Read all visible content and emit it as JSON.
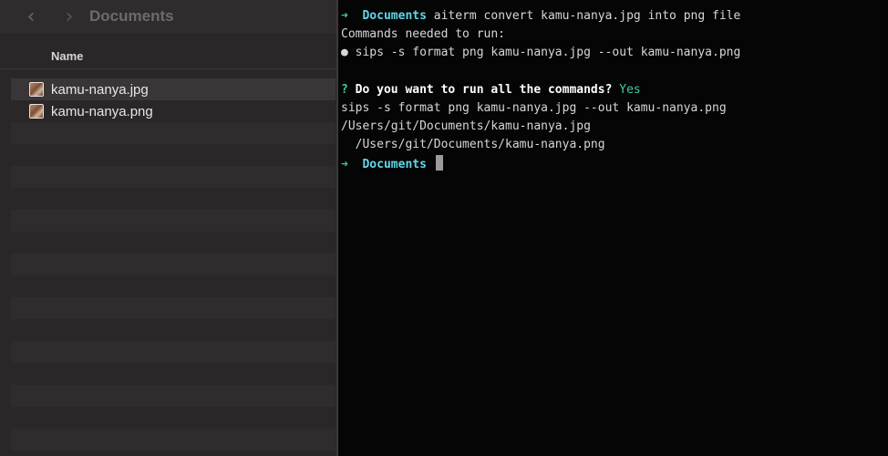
{
  "finder": {
    "title": "Documents",
    "back_icon": "chevron-left-icon",
    "forward_icon": "chevron-right-icon",
    "column_name": "Name",
    "files": [
      {
        "name": "kamu-nanya.jpg",
        "icon": "image-file-icon",
        "selected": true
      },
      {
        "name": "kamu-nanya.png",
        "icon": "image-file-icon",
        "selected": false
      }
    ]
  },
  "terminal": {
    "prompt_arrow": "➜",
    "prompt_dir": "Documents",
    "command": "aiterm convert kamu-nanya.jpg into png file",
    "needed_label": "Commands needed to run:",
    "bullet": "●",
    "planned_command": "sips -s format png kamu-nanya.jpg --out kamu-nanya.png",
    "question_mark": "?",
    "question": "Do you want to run all the commands?",
    "answer": "Yes",
    "output_lines": [
      "sips -s format png kamu-nanya.jpg --out kamu-nanya.png",
      "/Users/git/Documents/kamu-nanya.jpg",
      "  /Users/git/Documents/kamu-nanya.png"
    ]
  },
  "colors": {
    "prompt_accent": "#41c9a8",
    "dir_color": "#5fd7e8",
    "finder_bg": "#2b2728",
    "terminal_bg": "#050505"
  }
}
